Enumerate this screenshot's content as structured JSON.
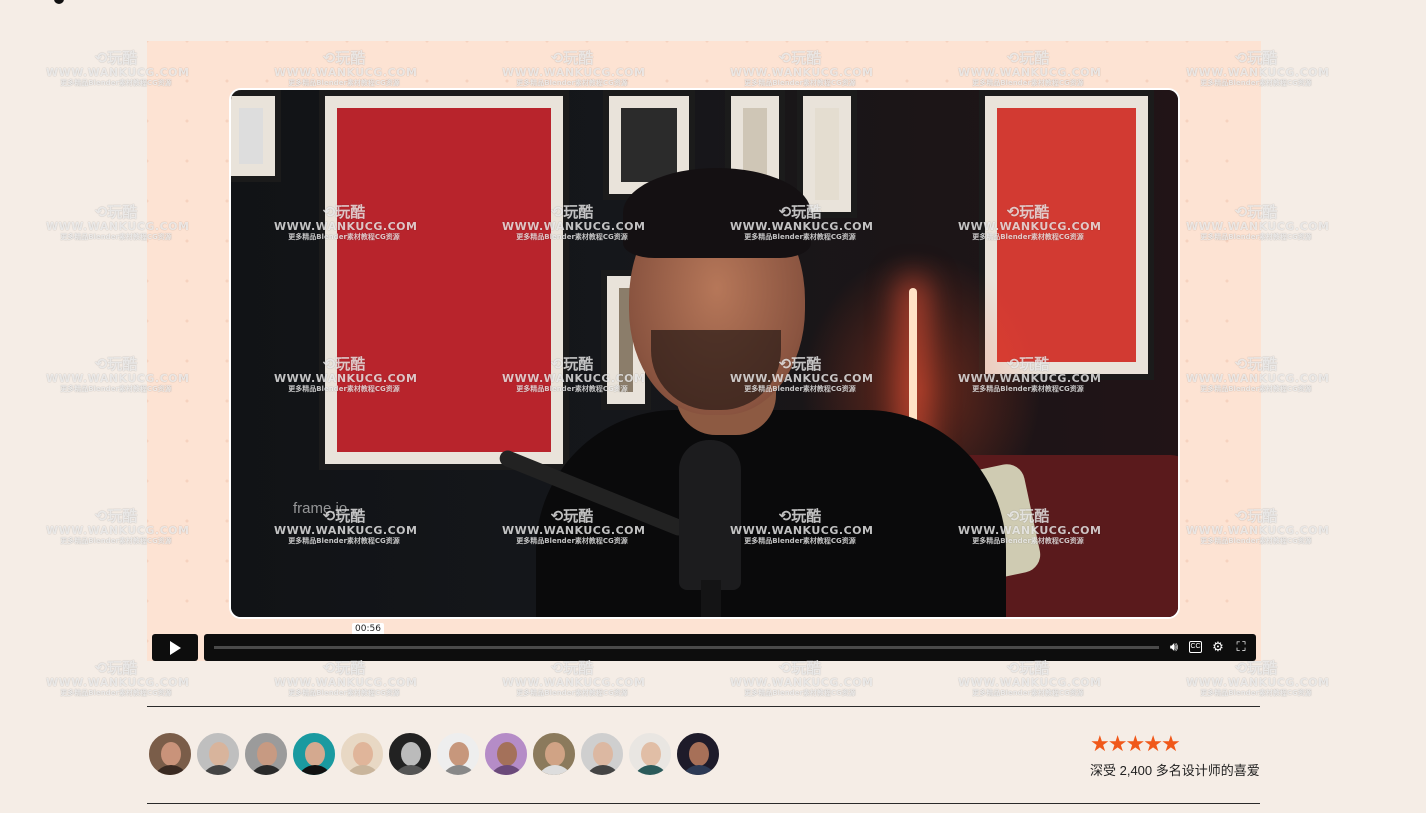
{
  "video": {
    "timestamp": "00:56",
    "brand_overlay": "frame.io",
    "controls": {
      "play_icon": "play-icon",
      "volume_icon": "volume-icon",
      "cc_label": "CC",
      "settings_icon": "gear-icon",
      "fullscreen_icon": "fullscreen-icon"
    }
  },
  "social_proof": {
    "avatar_count": 12,
    "stars": 5,
    "text": "深受 2,400 多名设计师的喜爱"
  },
  "watermark": {
    "brand": "玩酷",
    "site": "WWW.WANKUCG.COM",
    "tagline": "更多精品Blender素材教程CG资源"
  },
  "colors": {
    "background": "#f5ede6",
    "stage": "#fde3d3",
    "star": "#f0581a",
    "controls": "#0d0d0d"
  }
}
